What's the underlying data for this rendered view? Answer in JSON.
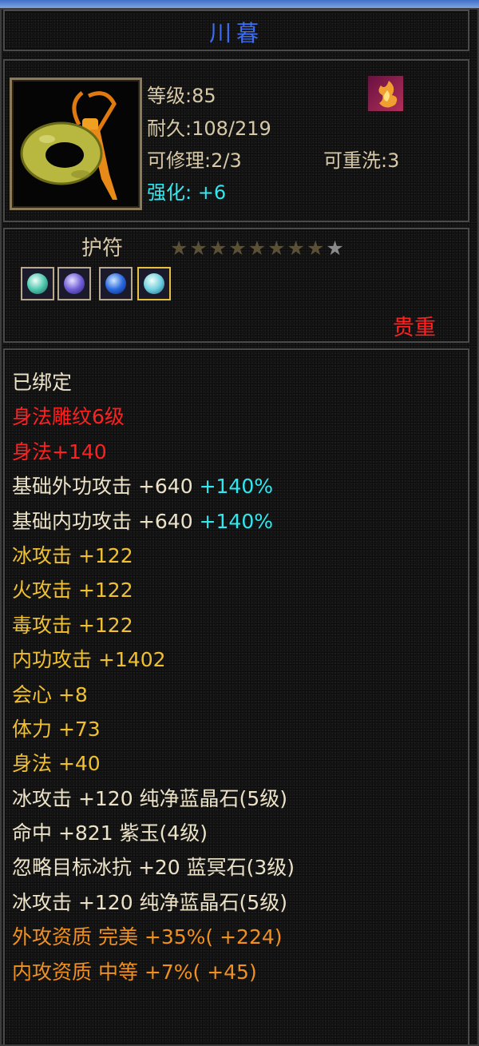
{
  "item": {
    "name": "川暮",
    "level": "等级:85",
    "durability": "耐久:108/219",
    "repair": "可修理:2/3",
    "rewash": "可重洗:3",
    "enhance_label": "强化:",
    "enhance_value": "+6",
    "type": "护符",
    "rarity": "贵重",
    "stars": [
      "dim",
      "dim",
      "dim",
      "dim",
      "dim",
      "dim",
      "dim",
      "dim",
      "grey"
    ],
    "gems": [
      "pale-teal-gem-icon",
      "purple-gem-icon",
      "blue-gem-icon",
      "cyan-gem-icon"
    ]
  },
  "colors": {
    "title": "#3d6cf0",
    "stat": "#d7c9a8",
    "enhance": "#30e8f0",
    "rarity": "#ff2020",
    "attr_light": "#ece2c8",
    "attr_red": "#ff2020",
    "attr_gold": "#f0c030",
    "attr_orange": "#f09020",
    "attr_cyan": "#30e8f0"
  },
  "attributes": [
    {
      "text": "已绑定",
      "color": "light"
    },
    {
      "text": "身法雕纹6级",
      "color": "red"
    },
    {
      "text": "身法+140",
      "color": "red"
    },
    {
      "text": "基础外功攻击 +640 ",
      "color": "light",
      "extra": "+140%"
    },
    {
      "text": "基础内功攻击 +640 ",
      "color": "light",
      "extra": "+140%"
    },
    {
      "text": "冰攻击 +122",
      "color": "gold"
    },
    {
      "text": "火攻击 +122",
      "color": "gold"
    },
    {
      "text": "毒攻击 +122",
      "color": "gold"
    },
    {
      "text": "内功攻击 +1402",
      "color": "gold"
    },
    {
      "text": "会心 +8",
      "color": "gold"
    },
    {
      "text": "体力 +73",
      "color": "gold"
    },
    {
      "text": "身法 +40",
      "color": "gold"
    },
    {
      "text": "冰攻击 +120 纯净蓝晶石(5级)",
      "color": "light"
    },
    {
      "text": "命中 +821 紫玉(4级)",
      "color": "light"
    },
    {
      "text": "忽略目标冰抗 +20 蓝冥石(3级)",
      "color": "light"
    },
    {
      "text": "冰攻击 +120 纯净蓝晶石(5级)",
      "color": "light"
    },
    {
      "text": "外攻资质  完美 +35%( +224)",
      "color": "orange"
    },
    {
      "text": "内攻资质  中等 +7%( +45)",
      "color": "orange"
    }
  ]
}
